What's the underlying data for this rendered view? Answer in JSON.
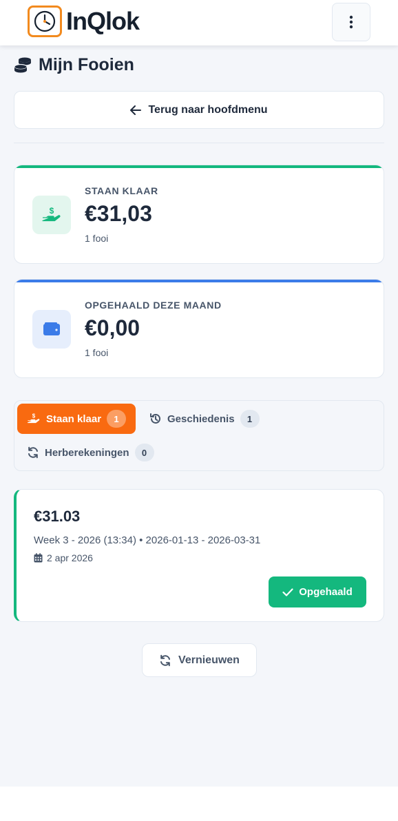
{
  "header": {
    "brand_name": "InQlok",
    "menu_icon": "vertical-ellipsis-icon",
    "logo_color": "#f28a1e"
  },
  "page": {
    "title": "Mijn Fooien",
    "title_icon": "coins-icon",
    "back_button_label": "Terug naar hoofdmenu"
  },
  "stats": [
    {
      "label": "STAAN KLAAR",
      "amount": "€31,03",
      "count_text": "1 fooi",
      "icon": "hand-holding-dollar-icon",
      "accent": "#14b87e"
    },
    {
      "label": "OPGEHAALD DEZE MAAND",
      "amount": "€0,00",
      "count_text": "1 fooi",
      "icon": "wallet-icon",
      "accent": "#3b7be8"
    }
  ],
  "tabs": [
    {
      "label": "Staan klaar",
      "count": "1",
      "active": true,
      "icon": "hand-holding-dollar-icon"
    },
    {
      "label": "Geschiedenis",
      "count": "1",
      "active": false,
      "icon": "history-icon"
    },
    {
      "label": "Herberekeningen",
      "count": "0",
      "active": false,
      "icon": "refresh-icon"
    }
  ],
  "tips": [
    {
      "amount": "€31.03",
      "description": "Week 3 - 2026 (13:34) • 2026-01-13 - 2026-03-31",
      "date": "2 apr 2026",
      "action_label": "Opgehaald",
      "accent": "#14b87e"
    }
  ],
  "refresh_button_label": "Vernieuwen",
  "colors": {
    "primary_orange": "#f96a10",
    "success_green": "#14b87e",
    "info_blue": "#3b7be8",
    "background": "#f4f6fa"
  }
}
